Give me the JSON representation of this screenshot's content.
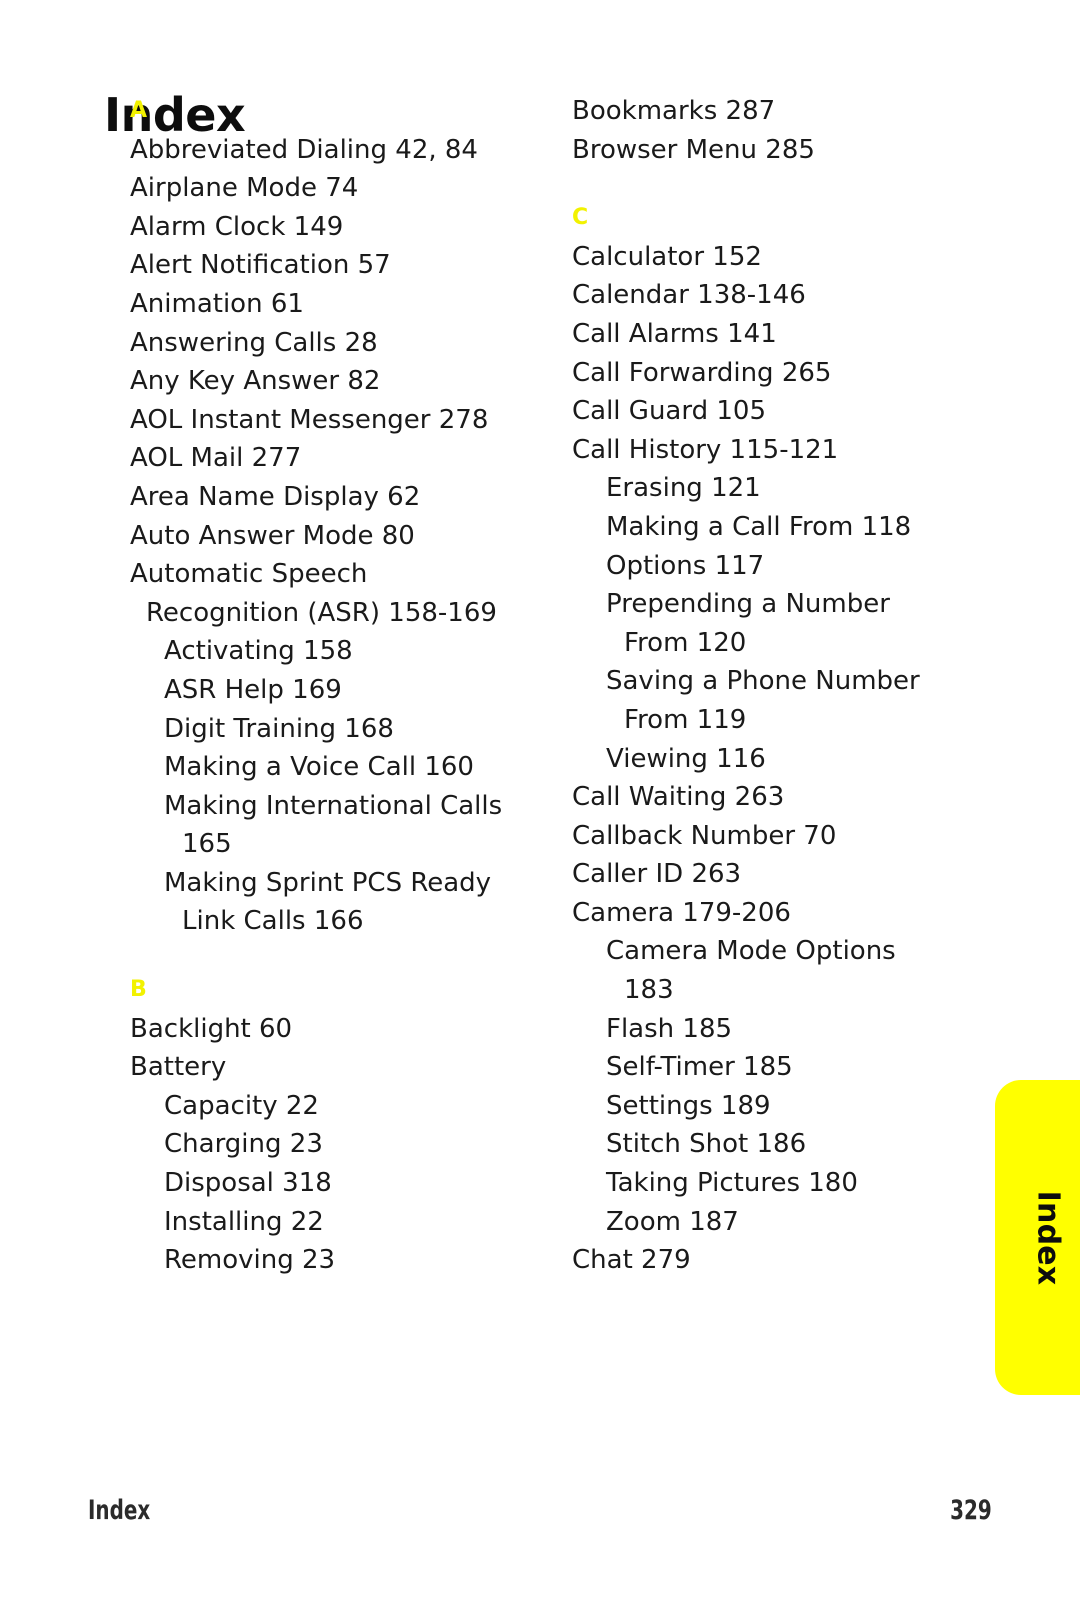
{
  "page": {
    "title": "Index",
    "footer_label": "Index",
    "footer_page": "329",
    "side_tab_label": "Index",
    "accent_color": "#ffff00",
    "letter_color": "#f2f200",
    "text_color": "#1a1a1a",
    "background_color": "#ffffff"
  },
  "columns": {
    "left": [
      {
        "kind": "letter",
        "text": "A"
      },
      {
        "kind": "entry",
        "level": 0,
        "text": "Abbreviated Dialing 42, 84"
      },
      {
        "kind": "entry",
        "level": 0,
        "text": "Airplane Mode 74"
      },
      {
        "kind": "entry",
        "level": 0,
        "text": "Alarm Clock 149"
      },
      {
        "kind": "entry",
        "level": 0,
        "text": "Alert Notification 57"
      },
      {
        "kind": "entry",
        "level": 0,
        "text": "Animation 61"
      },
      {
        "kind": "entry",
        "level": 0,
        "text": "Answering Calls 28"
      },
      {
        "kind": "entry",
        "level": 0,
        "text": "Any Key Answer 82"
      },
      {
        "kind": "entry",
        "level": 0,
        "text": "AOL Instant Messenger 278"
      },
      {
        "kind": "entry",
        "level": 0,
        "text": "AOL Mail 277"
      },
      {
        "kind": "entry",
        "level": 0,
        "text": "Area Name Display 62"
      },
      {
        "kind": "entry",
        "level": 0,
        "text": "Auto Answer Mode 80"
      },
      {
        "kind": "entry",
        "level": 0,
        "text": "Automatic Speech"
      },
      {
        "kind": "entry",
        "level": "0w",
        "text": "Recognition (ASR) 158-169"
      },
      {
        "kind": "entry",
        "level": 1,
        "text": "Activating 158"
      },
      {
        "kind": "entry",
        "level": 1,
        "text": "ASR Help 169"
      },
      {
        "kind": "entry",
        "level": 1,
        "text": "Digit Training 168"
      },
      {
        "kind": "entry",
        "level": 1,
        "text": "Making a Voice Call 160"
      },
      {
        "kind": "entry",
        "level": 1,
        "text": "Making International Calls"
      },
      {
        "kind": "entry",
        "level": "1w",
        "text": "165"
      },
      {
        "kind": "entry",
        "level": 1,
        "text": "Making Sprint PCS Ready"
      },
      {
        "kind": "entry",
        "level": "1w",
        "text": "Link Calls 166"
      },
      {
        "kind": "letter",
        "text": "B",
        "spaced": true
      },
      {
        "kind": "entry",
        "level": 0,
        "text": "Backlight 60"
      },
      {
        "kind": "entry",
        "level": 0,
        "text": "Battery"
      },
      {
        "kind": "entry",
        "level": 1,
        "text": "Capacity 22"
      },
      {
        "kind": "entry",
        "level": 1,
        "text": "Charging 23"
      },
      {
        "kind": "entry",
        "level": 1,
        "text": "Disposal 318"
      },
      {
        "kind": "entry",
        "level": 1,
        "text": "Installing 22"
      },
      {
        "kind": "entry",
        "level": 1,
        "text": "Removing 23"
      }
    ],
    "right": [
      {
        "kind": "entry",
        "level": 0,
        "text": "Bookmarks 287"
      },
      {
        "kind": "entry",
        "level": 0,
        "text": "Browser Menu 285"
      },
      {
        "kind": "letter",
        "text": "C",
        "spaced": true
      },
      {
        "kind": "entry",
        "level": 0,
        "text": "Calculator 152"
      },
      {
        "kind": "entry",
        "level": 0,
        "text": "Calendar 138-146"
      },
      {
        "kind": "entry",
        "level": 0,
        "text": "Call Alarms 141"
      },
      {
        "kind": "entry",
        "level": 0,
        "text": "Call Forwarding 265"
      },
      {
        "kind": "entry",
        "level": 0,
        "text": "Call Guard 105"
      },
      {
        "kind": "entry",
        "level": 0,
        "text": "Call History 115-121"
      },
      {
        "kind": "entry",
        "level": 1,
        "text": "Erasing 121"
      },
      {
        "kind": "entry",
        "level": 1,
        "text": "Making a Call From 118"
      },
      {
        "kind": "entry",
        "level": 1,
        "text": "Options 117"
      },
      {
        "kind": "entry",
        "level": 1,
        "text": "Prepending a Number"
      },
      {
        "kind": "entry",
        "level": "1w",
        "text": "From 120"
      },
      {
        "kind": "entry",
        "level": 1,
        "text": "Saving a Phone Number"
      },
      {
        "kind": "entry",
        "level": "1w",
        "text": "From 119"
      },
      {
        "kind": "entry",
        "level": 1,
        "text": "Viewing 116"
      },
      {
        "kind": "entry",
        "level": 0,
        "text": "Call Waiting 263"
      },
      {
        "kind": "entry",
        "level": 0,
        "text": "Callback Number 70"
      },
      {
        "kind": "entry",
        "level": 0,
        "text": "Caller ID 263"
      },
      {
        "kind": "entry",
        "level": 0,
        "text": "Camera 179-206"
      },
      {
        "kind": "entry",
        "level": 1,
        "text": "Camera Mode Options"
      },
      {
        "kind": "entry",
        "level": "1w",
        "text": "183"
      },
      {
        "kind": "entry",
        "level": 1,
        "text": "Flash 185"
      },
      {
        "kind": "entry",
        "level": 1,
        "text": "Self-Timer 185"
      },
      {
        "kind": "entry",
        "level": 1,
        "text": "Settings 189"
      },
      {
        "kind": "entry",
        "level": 1,
        "text": "Stitch Shot 186"
      },
      {
        "kind": "entry",
        "level": 1,
        "text": "Taking Pictures 180"
      },
      {
        "kind": "entry",
        "level": 1,
        "text": "Zoom 187"
      },
      {
        "kind": "entry",
        "level": 0,
        "text": "Chat 279"
      }
    ]
  }
}
